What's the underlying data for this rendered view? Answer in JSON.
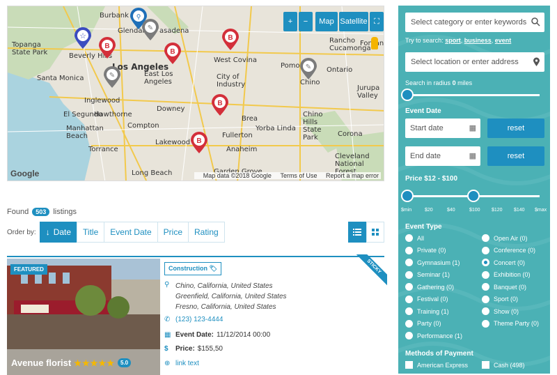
{
  "map": {
    "controls": {
      "zoom_in": "+",
      "zoom_out": "−",
      "map": "Map",
      "satellite": "Satellite",
      "fullscreen": "⛶"
    },
    "labels": [
      {
        "name": "label-burbank",
        "text": "Burbank"
      },
      {
        "name": "label-glendale",
        "text": "Glendale"
      },
      {
        "name": "label-pasadena",
        "text": "asadena"
      },
      {
        "name": "label-topanga",
        "text": "Topanga State Park"
      },
      {
        "name": "label-beverly-hills",
        "text": "Beverly Hills"
      },
      {
        "name": "label-los-angeles",
        "text": "Los Angeles"
      },
      {
        "name": "label-east-la",
        "text": "East Los Angeles"
      },
      {
        "name": "label-west-covina",
        "text": "West Covina"
      },
      {
        "name": "label-santa-monica",
        "text": "Santa Monica"
      },
      {
        "name": "label-city-industry",
        "text": "City of Industry"
      },
      {
        "name": "label-pomona",
        "text": "Pomona"
      },
      {
        "name": "label-ontario",
        "text": "Ontario"
      },
      {
        "name": "label-rancho",
        "text": "Rancho Cucamonga"
      },
      {
        "name": "label-fontana",
        "text": "Fontana"
      },
      {
        "name": "label-jurupa",
        "text": "Jurupa Valley"
      },
      {
        "name": "label-chino",
        "text": "Chino"
      },
      {
        "name": "label-inglewood",
        "text": "Inglewood"
      },
      {
        "name": "label-downey",
        "text": "Downey"
      },
      {
        "name": "label-el-segundo",
        "text": "El Segundo"
      },
      {
        "name": "label-hawthorne",
        "text": "Hawthorne"
      },
      {
        "name": "label-manhattan",
        "text": "Manhattan Beach"
      },
      {
        "name": "label-compton",
        "text": "Compton"
      },
      {
        "name": "label-brea",
        "text": "Brea"
      },
      {
        "name": "label-chino-hills",
        "text": "Chino Hills State Park"
      },
      {
        "name": "label-fullerton",
        "text": "Fullerton"
      },
      {
        "name": "label-yorba",
        "text": "Yorba Linda"
      },
      {
        "name": "label-corona",
        "text": "Corona"
      },
      {
        "name": "label-torrance",
        "text": "Torrance"
      },
      {
        "name": "label-lakewood",
        "text": "Lakewood"
      },
      {
        "name": "label-anaheim",
        "text": "Anaheim"
      },
      {
        "name": "label-long-beach",
        "text": "Long Beach"
      },
      {
        "name": "label-garden-grove",
        "text": "Garden Grove"
      },
      {
        "name": "label-cleveland",
        "text": "Cleveland National Forest"
      }
    ],
    "google": "Google",
    "footer": {
      "data": "Map data ©2018 Google",
      "terms": "Terms of Use",
      "report": "Report a map error"
    }
  },
  "results": {
    "found_prefix": "Found",
    "count": "503",
    "found_suffix": "listings",
    "order_label": "Order by:",
    "order_options": [
      "Date",
      "Title",
      "Event Date",
      "Price",
      "Rating"
    ]
  },
  "listing": {
    "featured": "FEATURED",
    "title": "Avenue florist",
    "stars": "★★★★★",
    "rating": "5.0",
    "category": "Construction",
    "sticky": "STICKY",
    "addresses": [
      "Chino, California, United States",
      "Greenfield, California, United States",
      "Fresno, California, United States"
    ],
    "phone": "(123) 123-4444",
    "event_date_label": "Event Date:",
    "event_date": "11/12/2014 00:00",
    "price_label": "Price:",
    "price": "$155,50",
    "link": "link text"
  },
  "sidebar": {
    "search_placeholder": "Select category or enter keywords",
    "try_prefix": "Try to search:",
    "try_links": [
      "sport",
      "business",
      "event"
    ],
    "location_placeholder": "Select location or enter address",
    "radius_label": "Search in radius",
    "radius_value": "0",
    "radius_unit": "miles",
    "event_date_head": "Event Date",
    "start_date": "Start date",
    "end_date": "End date",
    "reset": "reset",
    "price_head": "Price $12 - $100",
    "price_min_fraction": 0.0,
    "price_max_fraction": 0.5,
    "radius_fraction": 0.0,
    "price_ticks": [
      "$min",
      "$20",
      "$40",
      "$100",
      "$120",
      "$140",
      "$max"
    ],
    "event_type_head": "Event Type",
    "types_left": [
      "All",
      "Private (0)",
      "Gymnasium (1)",
      "Seminar (1)",
      "Gathering (0)",
      "Festival (0)",
      "Training (1)",
      "Party (0)",
      "Performance (1)"
    ],
    "types_right": [
      "Open Air (0)",
      "Conference (0)",
      "Concert (0)",
      "Exhibition (0)",
      "Banquet (0)",
      "Sport (0)",
      "Show (0)",
      "Theme Party (0)"
    ],
    "selected_type": "Concert (0)",
    "payment_head": "Methods of Payment",
    "payments": [
      "American Express",
      "Cash (498)"
    ]
  },
  "colors": {
    "accent": "#1e8fc0",
    "sidebar": "#4bb1b5",
    "pin_red": "#d32f3a",
    "pin_gray": "#7b7b7b"
  }
}
